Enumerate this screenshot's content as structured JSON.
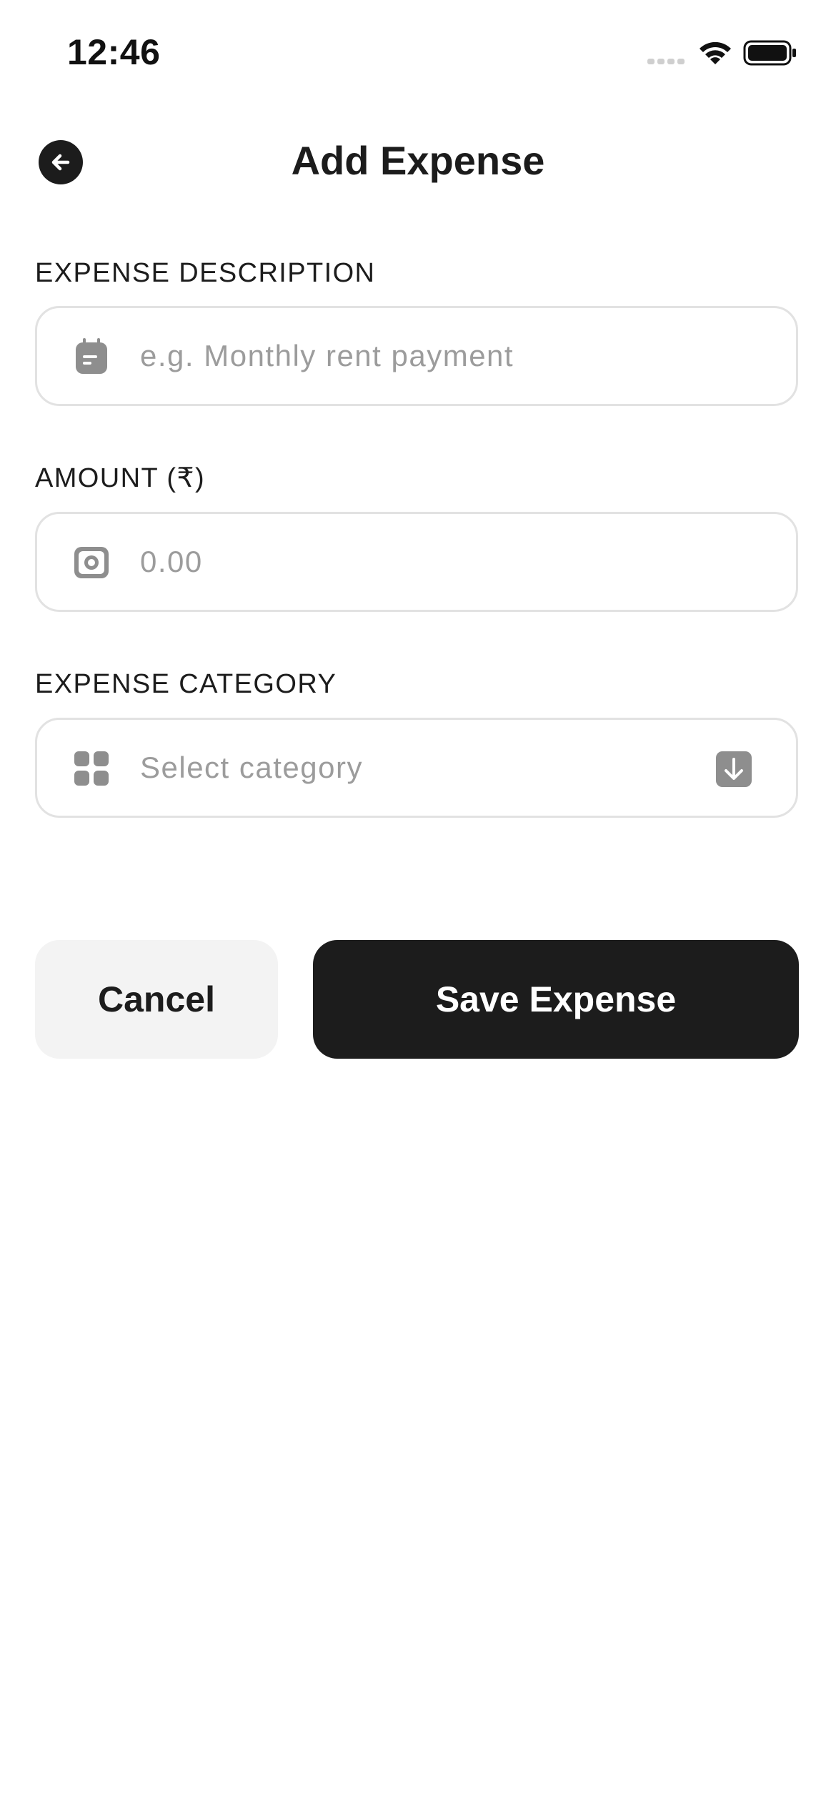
{
  "status_bar": {
    "time": "12:46"
  },
  "header": {
    "title": "Add Expense",
    "back_icon": "arrow-left-icon"
  },
  "form": {
    "description": {
      "label": "EXPENSE DESCRIPTION",
      "placeholder": "e.g. Monthly rent payment",
      "value": "",
      "icon": "clipboard-icon"
    },
    "amount": {
      "label": "AMOUNT (₹)",
      "placeholder": "0.00",
      "value": "",
      "icon": "money-icon"
    },
    "category": {
      "label": "EXPENSE CATEGORY",
      "placeholder": "Select category",
      "icon": "grid-icon",
      "dropdown_icon": "arrow-down-icon"
    }
  },
  "actions": {
    "cancel_label": "Cancel",
    "save_label": "Save Expense"
  },
  "colors": {
    "primary": "#1c1c1c",
    "secondary_button": "#f3f3f3",
    "border": "#e2e2e2",
    "placeholder": "#9c9c9c",
    "icon": "#8e8e8e"
  }
}
